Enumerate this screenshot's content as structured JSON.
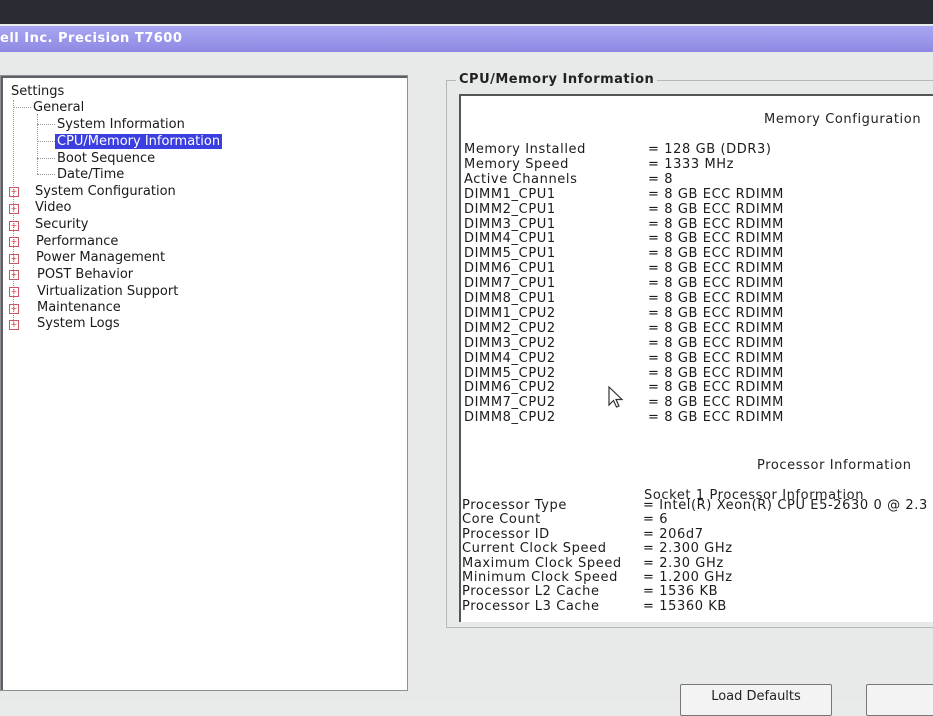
{
  "window": {
    "title": "ell Inc. Precision T7600"
  },
  "tree": {
    "root": "Settings",
    "general": "General",
    "general_children": [
      "System Information",
      "CPU/Memory Information",
      "Boot Sequence",
      "Date/Time"
    ],
    "collapsed": [
      "System Configuration",
      "Video",
      "Security",
      "Performance",
      "Power Management",
      "POST Behavior",
      "Virtualization Support",
      "Maintenance",
      "System Logs"
    ]
  },
  "panel": {
    "title": "CPU/Memory Information",
    "memory_heading": "Memory Configuration",
    "memory_rows": [
      {
        "label": "Memory Installed",
        "value": "= 128 GB (DDR3)"
      },
      {
        "label": "Memory Speed",
        "value": "= 1333 MHz"
      },
      {
        "label": "Active Channels",
        "value": "= 8"
      },
      {
        "label": "DIMM1_CPU1",
        "value": "= 8 GB ECC RDIMM"
      },
      {
        "label": "DIMM2_CPU1",
        "value": "= 8 GB ECC RDIMM"
      },
      {
        "label": "DIMM3_CPU1",
        "value": "= 8 GB ECC RDIMM"
      },
      {
        "label": "DIMM4_CPU1",
        "value": "= 8 GB ECC RDIMM"
      },
      {
        "label": "DIMM5_CPU1",
        "value": "= 8 GB ECC RDIMM"
      },
      {
        "label": "DIMM6_CPU1",
        "value": "= 8 GB ECC RDIMM"
      },
      {
        "label": "DIMM7_CPU1",
        "value": "= 8 GB ECC RDIMM"
      },
      {
        "label": "DIMM8_CPU1",
        "value": "= 8 GB ECC RDIMM"
      },
      {
        "label": "DIMM1_CPU2",
        "value": "= 8 GB ECC RDIMM"
      },
      {
        "label": "DIMM2_CPU2",
        "value": "= 8 GB ECC RDIMM"
      },
      {
        "label": "DIMM3_CPU2",
        "value": "= 8 GB ECC RDIMM"
      },
      {
        "label": "DIMM4_CPU2",
        "value": "= 8 GB ECC RDIMM"
      },
      {
        "label": "DIMM5_CPU2",
        "value": "= 8 GB ECC RDIMM"
      },
      {
        "label": "DIMM6_CPU2",
        "value": "= 8 GB ECC RDIMM"
      },
      {
        "label": "DIMM7_CPU2",
        "value": "= 8 GB ECC RDIMM"
      },
      {
        "label": "DIMM8_CPU2",
        "value": "= 8 GB ECC RDIMM"
      }
    ],
    "processor_heading": "Processor Information",
    "socket_heading": "Socket 1 Processor Information",
    "processor_rows": [
      {
        "label": "Processor Type",
        "value": "= Intel(R) Xeon(R) CPU E5-2630 0 @ 2.3"
      },
      {
        "label": "Core Count",
        "value": "= 6"
      },
      {
        "label": "Processor ID",
        "value": "= 206d7"
      },
      {
        "label": "Current Clock Speed",
        "value": "= 2.300 GHz"
      },
      {
        "label": "Maximum Clock Speed",
        "value": "= 2.30 GHz"
      },
      {
        "label": "Minimum Clock Speed",
        "value": "= 1.200 GHz"
      },
      {
        "label": "Processor L2 Cache",
        "value": "= 1536 KB"
      },
      {
        "label": "Processor L3 Cache",
        "value": "= 15360 KB"
      }
    ]
  },
  "buttons": {
    "load_defaults": "Load Defaults"
  }
}
